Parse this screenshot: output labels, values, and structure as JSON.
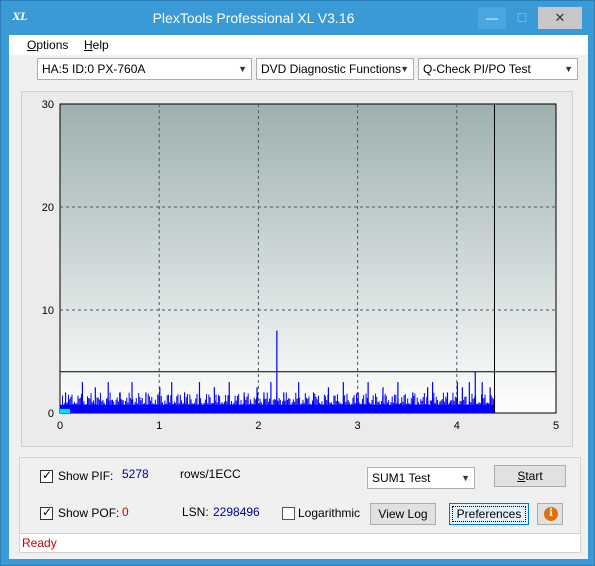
{
  "window": {
    "title": "PlexTools Professional XL V3.16",
    "icon_text": "XL"
  },
  "titlebar_buttons": {
    "minimize": "—",
    "maximize": "☐",
    "close": "✕"
  },
  "menu": {
    "options": "ptions",
    "options_key": "O",
    "help": "elp",
    "help_key": "H"
  },
  "toolbar": {
    "drive": "HA:5 ID:0  PX-760A",
    "function": "DVD Diagnostic Functions",
    "test": "Q-Check PI/PO Test"
  },
  "colors": {
    "accent": "#3a9ad6",
    "pif_bars": "#0000ff",
    "status": "#cc0000"
  },
  "chart_data": {
    "type": "bar",
    "xlim": [
      0,
      5
    ],
    "ylim": [
      0,
      30
    ],
    "x_ticks": [
      "0",
      "1",
      "2",
      "3",
      "4",
      "5"
    ],
    "y_ticks": [
      "0",
      "10",
      "20",
      "30"
    ],
    "threshold": 4,
    "scan_end": 4.38,
    "grid": true,
    "spikes": [
      {
        "x": 0.05,
        "y": 2.0
      },
      {
        "x": 0.22,
        "y": 3.0
      },
      {
        "x": 0.35,
        "y": 2.5
      },
      {
        "x": 0.48,
        "y": 3.0
      },
      {
        "x": 0.6,
        "y": 2.0
      },
      {
        "x": 0.72,
        "y": 3.0
      },
      {
        "x": 0.86,
        "y": 2.0
      },
      {
        "x": 1.0,
        "y": 2.5
      },
      {
        "x": 1.12,
        "y": 3.0
      },
      {
        "x": 1.25,
        "y": 2.0
      },
      {
        "x": 1.4,
        "y": 3.0
      },
      {
        "x": 1.55,
        "y": 2.5
      },
      {
        "x": 1.7,
        "y": 3.0
      },
      {
        "x": 1.85,
        "y": 2.0
      },
      {
        "x": 1.98,
        "y": 2.5
      },
      {
        "x": 2.05,
        "y": 2.0
      },
      {
        "x": 2.12,
        "y": 3.0
      },
      {
        "x": 2.18,
        "y": 8.0
      },
      {
        "x": 2.25,
        "y": 2.0
      },
      {
        "x": 2.4,
        "y": 3.0
      },
      {
        "x": 2.55,
        "y": 2.0
      },
      {
        "x": 2.7,
        "y": 2.5
      },
      {
        "x": 2.85,
        "y": 3.0
      },
      {
        "x": 3.0,
        "y": 2.0
      },
      {
        "x": 3.1,
        "y": 3.0
      },
      {
        "x": 3.25,
        "y": 2.5
      },
      {
        "x": 3.4,
        "y": 3.0
      },
      {
        "x": 3.55,
        "y": 2.0
      },
      {
        "x": 3.7,
        "y": 2.5
      },
      {
        "x": 3.75,
        "y": 3.0
      },
      {
        "x": 3.9,
        "y": 2.0
      },
      {
        "x": 4.0,
        "y": 3.0
      },
      {
        "x": 4.05,
        "y": 2.5
      },
      {
        "x": 4.12,
        "y": 3.0
      },
      {
        "x": 4.18,
        "y": 4.0
      },
      {
        "x": 4.25,
        "y": 3.0
      },
      {
        "x": 4.33,
        "y": 2.5
      }
    ]
  },
  "panel": {
    "show_pif_label": "Show PIF:",
    "pif_value": "5278",
    "pif_unit": "rows/1ECC",
    "show_pof_label": "Show POF:",
    "pof_value": "0",
    "lsn_label": "LSN:",
    "lsn_value": "2298496",
    "log_label": "Logarithmic",
    "sum_select": "SUM1 Test",
    "start_key": "S",
    "start_rest": "tart",
    "view_log": "View Log",
    "preferences": "Preferences",
    "info_glyph": "i",
    "check_glyph": "✓"
  },
  "status": {
    "text": "Ready"
  }
}
